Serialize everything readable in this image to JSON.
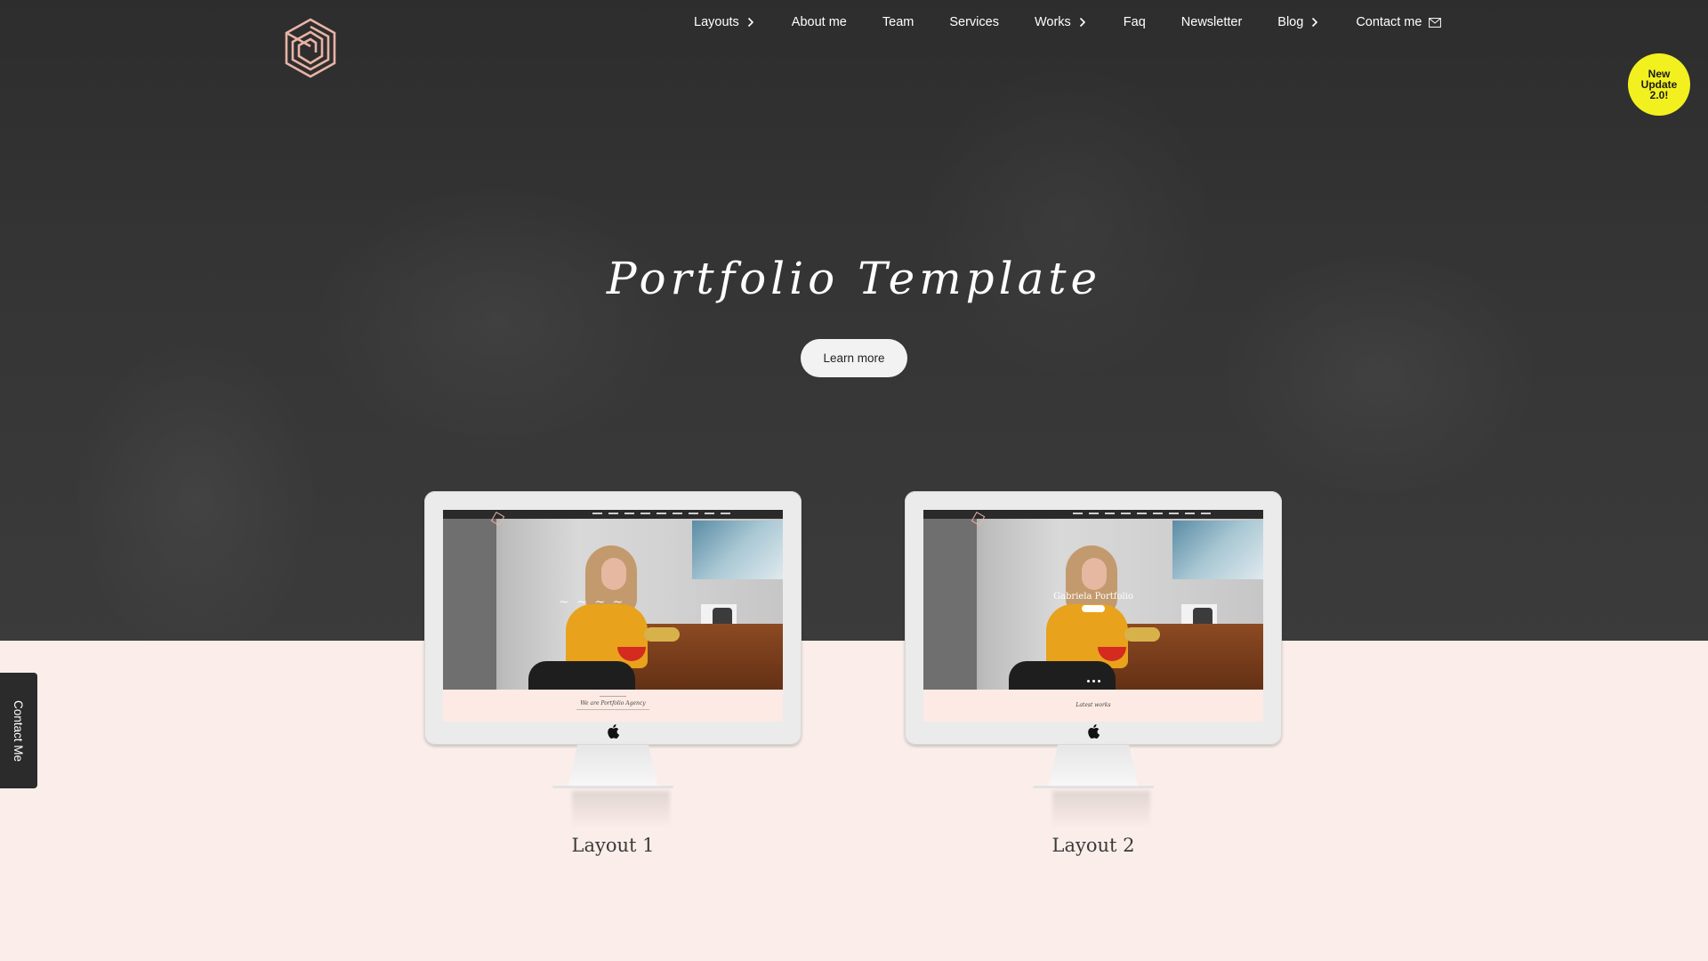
{
  "nav": {
    "items": [
      {
        "label": "Layouts",
        "has_chevron": true
      },
      {
        "label": "About me",
        "has_chevron": false
      },
      {
        "label": "Team",
        "has_chevron": false
      },
      {
        "label": "Services",
        "has_chevron": false
      },
      {
        "label": "Works",
        "has_chevron": true
      },
      {
        "label": "Faq",
        "has_chevron": false
      },
      {
        "label": "Newsletter",
        "has_chevron": false
      },
      {
        "label": "Blog",
        "has_chevron": true
      },
      {
        "label": "Contact me",
        "has_icon": "mail-icon"
      }
    ]
  },
  "badge": {
    "text": "New Update 2.0!",
    "color": "#f3f01f"
  },
  "hero": {
    "title": "Portfolio Template",
    "button_label": "Learn more"
  },
  "side_tab": {
    "label": "Contact Me"
  },
  "layouts": [
    {
      "label": "Layout 1",
      "preview": {
        "heading": "We are Portfolio Agency"
      }
    },
    {
      "label": "Layout 2",
      "preview": {
        "hero_name": "Gabriela Portfolio",
        "heading": "Latest works"
      }
    }
  ],
  "colors": {
    "hero_bg": "#333333",
    "page_bg": "#fbeeea",
    "logo": "#e9b3a5",
    "button_bg": "#f2f2f2"
  },
  "icons": [
    "logo-icon",
    "chevron-right-icon",
    "mail-icon",
    "apple-icon"
  ]
}
